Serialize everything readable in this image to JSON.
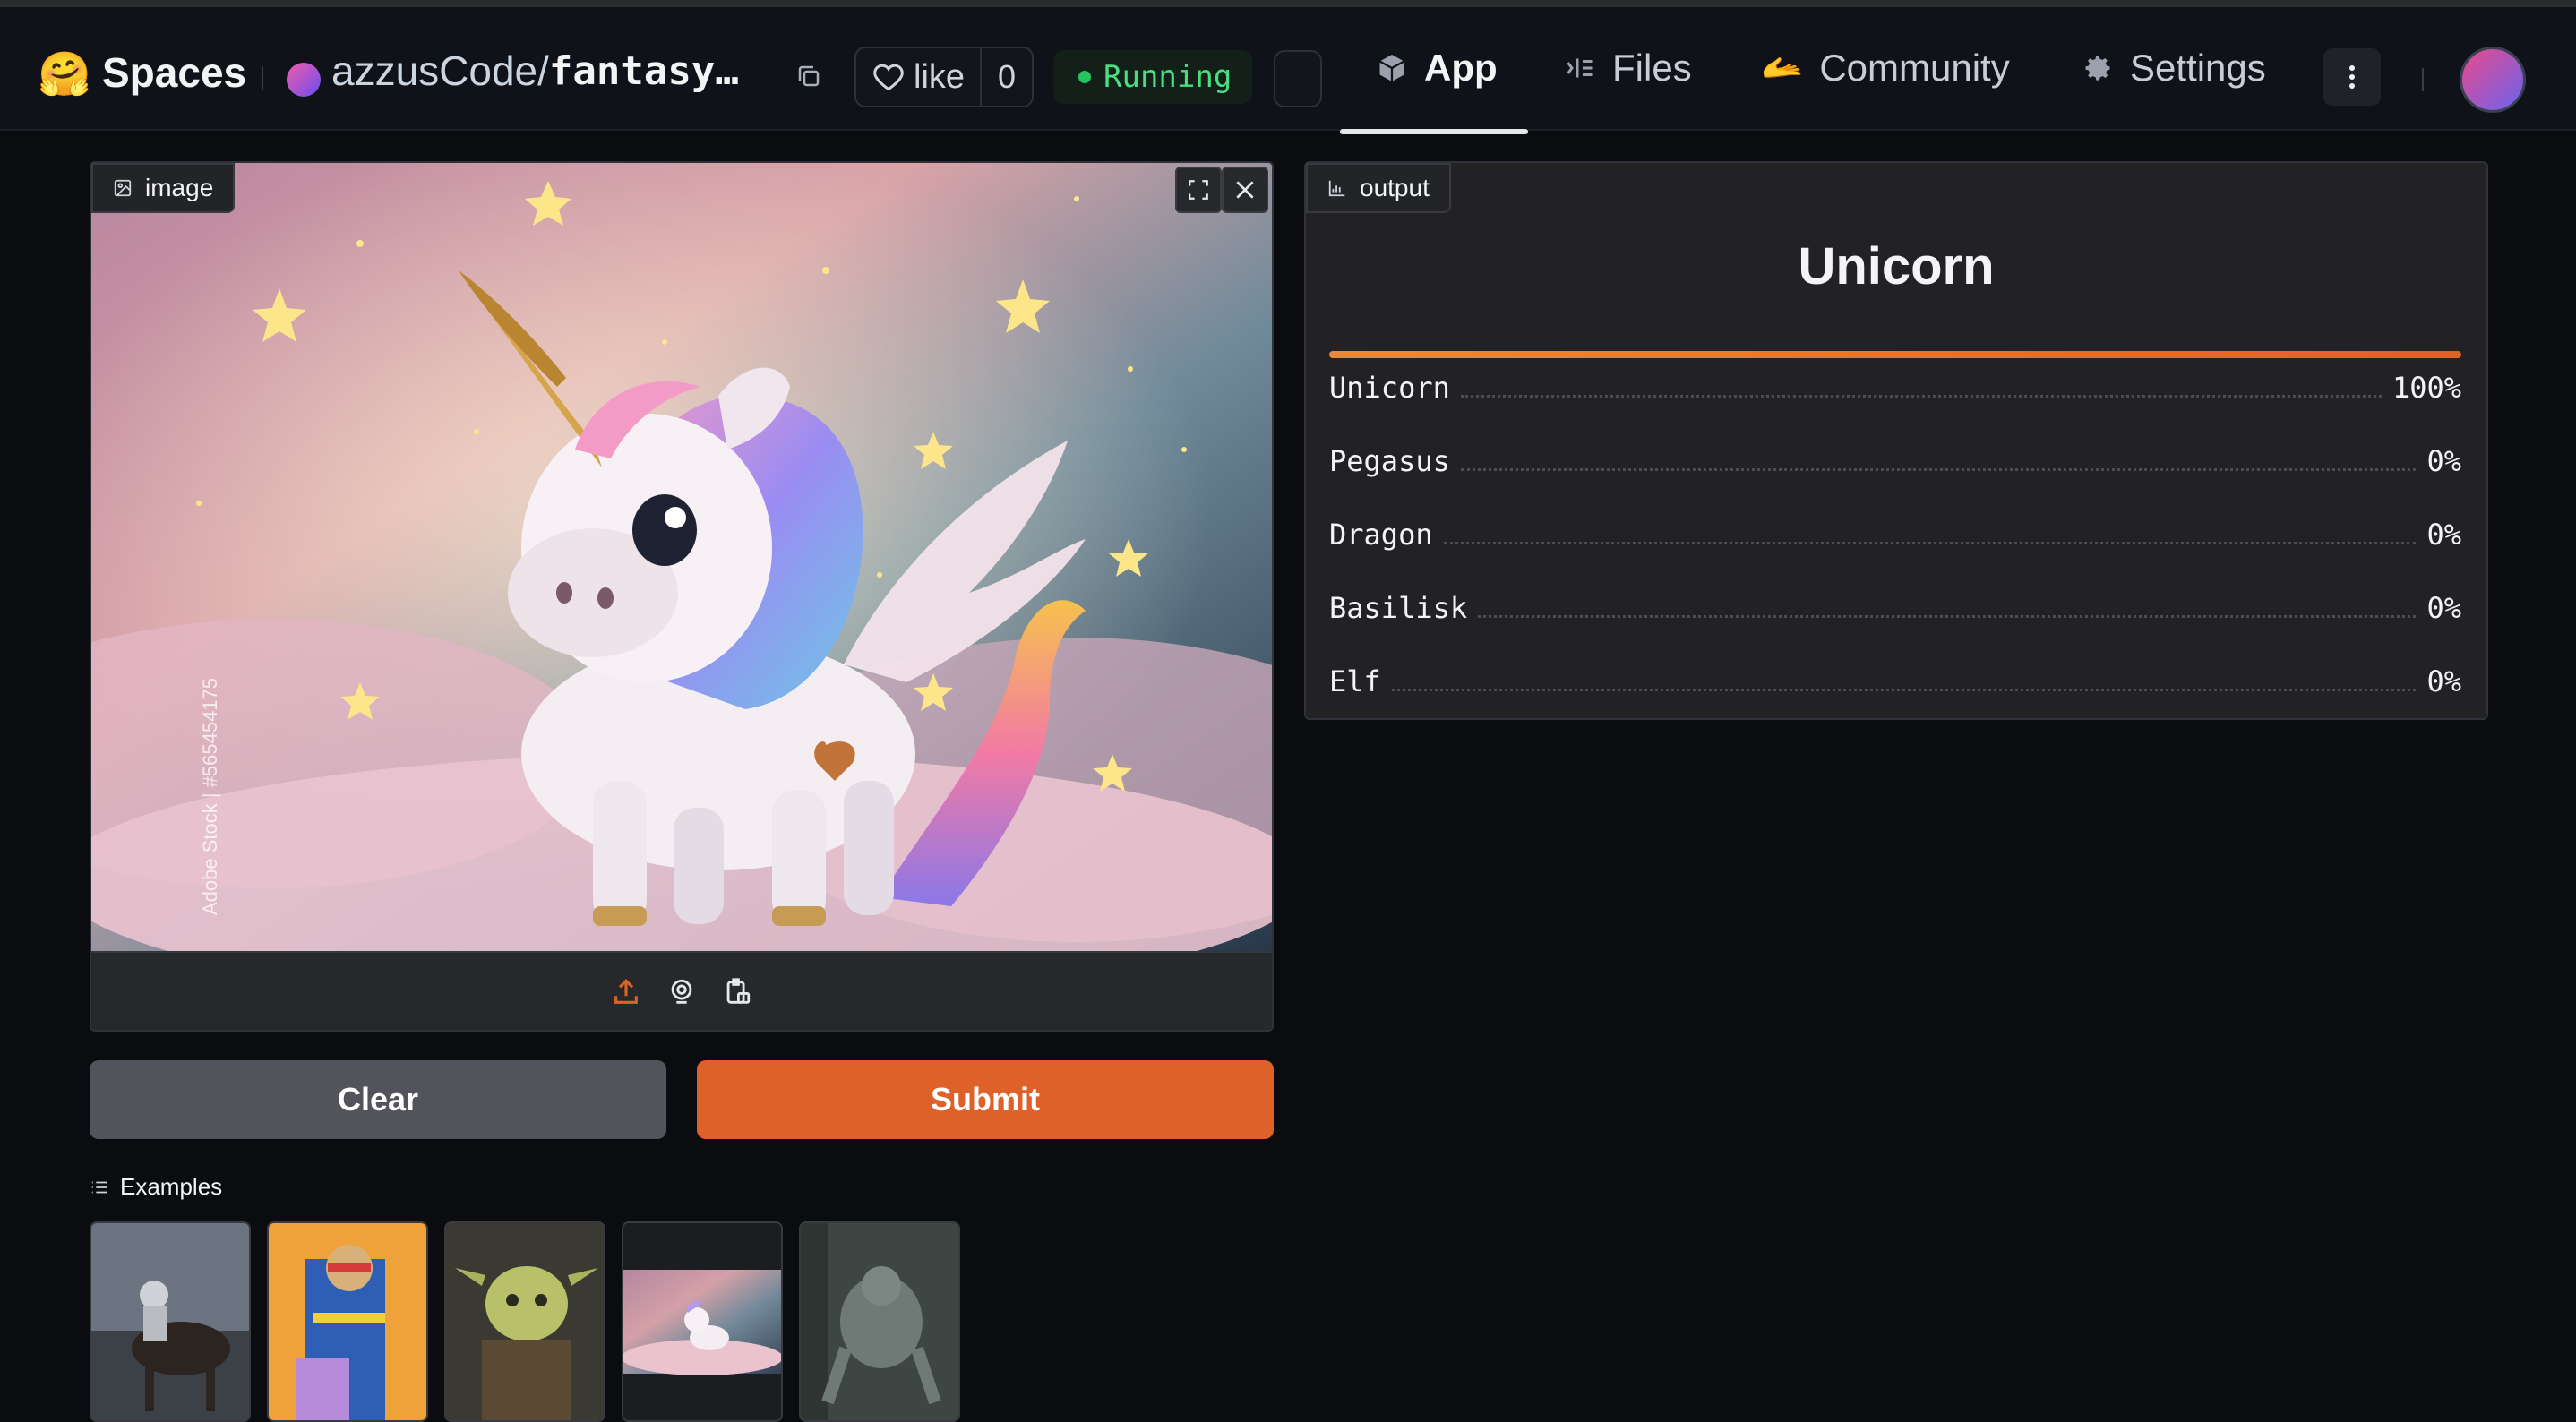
{
  "navbar": {
    "brand": "Spaces",
    "owner": "azzusCode",
    "separator": "/",
    "repo_name": "fantasy…",
    "like_label": "like",
    "like_count": "0",
    "status": "Running",
    "tabs": [
      {
        "label": "App"
      },
      {
        "label": "Files"
      },
      {
        "label": "Community"
      },
      {
        "label": "Settings"
      }
    ]
  },
  "input_panel": {
    "label": "image",
    "watermark": "Adobe Stock | #565454175"
  },
  "buttons": {
    "clear": "Clear",
    "submit": "Submit"
  },
  "examples": {
    "label": "Examples",
    "items": [
      "centaur",
      "armored-hero",
      "goblin",
      "unicorn",
      "werewolf"
    ]
  },
  "output_panel": {
    "label": "output",
    "top_label": "Unicorn",
    "confidences": [
      {
        "label": "Unicorn",
        "value": "100%"
      },
      {
        "label": "Pegasus",
        "value": "0%"
      },
      {
        "label": "Dragon",
        "value": "0%"
      },
      {
        "label": "Basilisk",
        "value": "0%"
      },
      {
        "label": "Elf",
        "value": "0%"
      }
    ],
    "top_confidence": 1.0
  },
  "colors": {
    "accent": "#de6129",
    "running": "#4ade80",
    "background": "#0b0c0f"
  }
}
